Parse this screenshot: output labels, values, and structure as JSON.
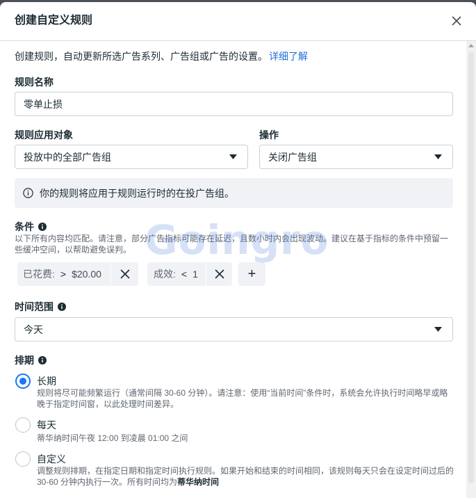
{
  "dialog": {
    "title": "创建自定义规则",
    "close_icon": "close-icon"
  },
  "intro": {
    "text": "创建规则，自动更新所选广告系列、广告组或广告的设置。",
    "link": "详细了解"
  },
  "rule_name": {
    "label": "规则名称",
    "value": "零单止损"
  },
  "apply_to": {
    "label": "规则应用对象",
    "selected": "投放中的全部广告组"
  },
  "action": {
    "label": "操作",
    "selected": "关闭广告组"
  },
  "notice": {
    "icon": "info-outline-icon",
    "text": "你的规则将应用于规则运行时的在投广告组。"
  },
  "conditions": {
    "label": "条件",
    "icon": "info-icon",
    "description": "以下所有内容均匹配。请注意，部分广告指标可能存在延迟，且数小时内会出现波动。建议在基于指标的条件中预留一些缓冲空间，以帮助避免误判。",
    "items": [
      {
        "metric": "已花费:",
        "operator": ">",
        "value": "$20.00"
      },
      {
        "metric": "成效:",
        "operator": "<",
        "value": "1"
      }
    ],
    "add_label": "+"
  },
  "time_range": {
    "label": "时间范围",
    "icon": "info-icon",
    "selected": "今天"
  },
  "schedule": {
    "label": "排期",
    "icon": "info-icon",
    "options": [
      {
        "title": "长期",
        "description": "规则将尽可能频繁运行（通常间隔 30-60 分钟）。请注意：使用“当前时间”条件时，系统会允许执行时间略早或略晚于指定时间窗，以此处理时间差异。",
        "selected": true
      },
      {
        "title": "每天",
        "description": "蒂华纳时间午夜 12:00 到凌晨 01:00 之间",
        "selected": false
      },
      {
        "title": "自定义",
        "description": "调整规则排期，在指定日期和指定时间执行规则。如果开始和结束的时间相同，该规则每天只会在设定时间过后的 30-60 分钟内执行一次。所有时间均为",
        "description_bold": "蒂华纳时间",
        "selected": false
      }
    ]
  },
  "watermark": "Goingro",
  "colors": {
    "accent": "#1877f2",
    "link": "#216fdb",
    "text": "#1c2b33",
    "muted": "#606770",
    "border": "#ccd0d5",
    "panel": "#f0f2f5"
  }
}
